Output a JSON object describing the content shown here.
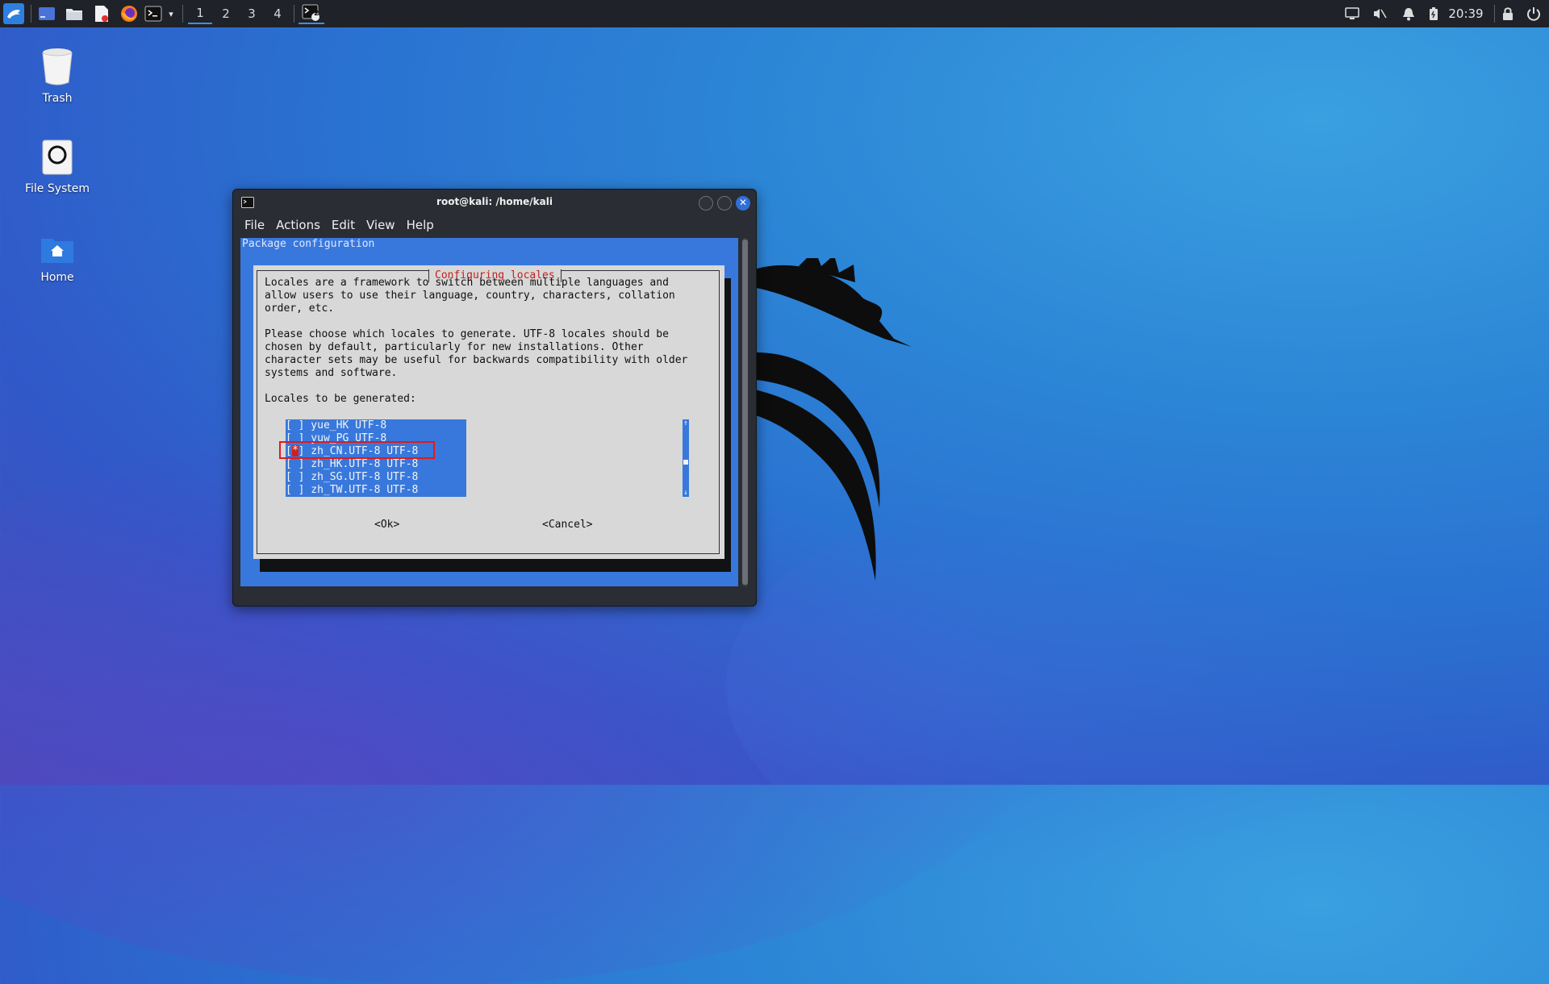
{
  "taskbar": {
    "workspaces": [
      "1",
      "2",
      "3",
      "4"
    ],
    "active_workspace": "1",
    "terminal_badge": "2",
    "clock": "20:39",
    "icons": [
      "kali-menu-icon",
      "show-desktop-icon",
      "file-manager-icon",
      "text-editor-icon",
      "firefox-icon",
      "terminal-icon",
      "chevron-down-icon",
      "terminal-task-icon",
      "screen-icon",
      "mute-icon",
      "notification-bell-icon",
      "battery-icon",
      "lock-icon",
      "power-icon"
    ]
  },
  "desktop": {
    "icons": [
      {
        "label": "Trash",
        "icon": "trash-icon"
      },
      {
        "label": "File System",
        "icon": "drive-icon"
      },
      {
        "label": "Home",
        "icon": "home-folder-icon"
      }
    ]
  },
  "window": {
    "title": "root@kali: /home/kali",
    "menu": [
      "File",
      "Actions",
      "Edit",
      "View",
      "Help"
    ]
  },
  "terminal": {
    "header": "Package configuration",
    "dialog": {
      "title": "Configuring locales",
      "text": "Locales are a framework to switch between multiple languages and\nallow users to use their language, country, characters, collation\norder, etc.\n\nPlease choose which locales to generate. UTF-8 locales should be\nchosen by default, particularly for new installations. Other\ncharacter sets may be useful for backwards compatibility with older\nsystems and software.\n\nLocales to be generated:",
      "items": [
        {
          "text": "[ ] yue_HK UTF-8",
          "checked": false
        },
        {
          "text": "[ ] yuw_PG UTF-8",
          "checked": false
        },
        {
          "text": "[*] zh_CN.UTF-8 UTF-8",
          "checked": true
        },
        {
          "text": "[ ] zh_HK.UTF-8 UTF-8",
          "checked": false
        },
        {
          "text": "[ ] zh_SG.UTF-8 UTF-8",
          "checked": false
        },
        {
          "text": "[ ] zh_TW.UTF-8 UTF-8",
          "checked": false
        }
      ],
      "scroll_up": "↑",
      "scroll_down": "↓",
      "ok_label": "<Ok>",
      "cancel_label": "<Cancel>"
    }
  },
  "colors": {
    "terminal_bg": "#3878dc",
    "dialog_bg": "#d8d8d8",
    "dialog_title": "#c41d1d",
    "highlight": "#e01a1a"
  }
}
